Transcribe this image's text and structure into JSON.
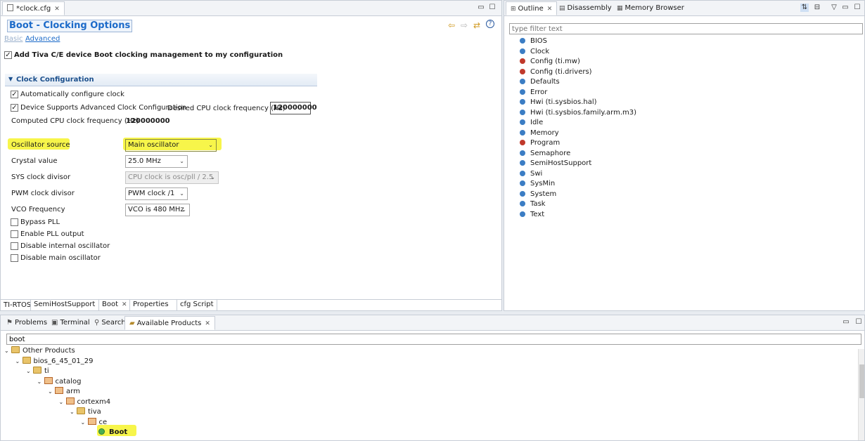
{
  "editor": {
    "tab_label": "*clock.cfg",
    "title": "Boot - Clocking Options",
    "mode_basic": "Basic",
    "mode_advanced": "Advanced",
    "add_config_label": "Add Tiva C/E device Boot clocking management to my configuration",
    "section_title": "Clock Configuration",
    "auto_config_label": "Automatically configure clock",
    "advanced_clock_label": "Device Supports Advanced Clock Configuration",
    "desired_freq_label": "Desired CPU clock frequency (Hz)",
    "desired_freq_value": "120000000",
    "computed_freq_label": "Computed CPU clock frequency (Hz)",
    "computed_freq_value": "120000000",
    "osc_source_label": "Oscillator source",
    "osc_source_value": "Main oscillator",
    "crystal_label": "Crystal value",
    "crystal_value": "25.0 MHz",
    "sys_div_label": "SYS clock divisor",
    "sys_div_value": "CPU clock is osc/pll / 2.5",
    "pwm_div_label": "PWM clock divisor",
    "pwm_div_value": "PWM clock /1",
    "vco_label": "VCO Frequency",
    "vco_value": "VCO is 480 MHz",
    "bypass_pll_label": "Bypass PLL",
    "enable_pll_label": "Enable PLL output",
    "disable_internal_label": "Disable internal oscillator",
    "disable_main_label": "Disable main oscillator",
    "bottom_tabs": [
      "TI-RTOS",
      "SemiHostSupport",
      "Boot",
      "Properties",
      "cfg Script"
    ]
  },
  "outline": {
    "tabs": [
      "Outline",
      "Disassembly",
      "Memory Browser"
    ],
    "filter_placeholder": "type filter text",
    "items": [
      {
        "label": "BIOS",
        "color": "#3b7dc4"
      },
      {
        "label": "Clock",
        "color": "#3b7dc4"
      },
      {
        "label": "Config (ti.mw)",
        "color": "#c0392b"
      },
      {
        "label": "Config (ti.drivers)",
        "color": "#c0392b"
      },
      {
        "label": "Defaults",
        "color": "#3b7dc4"
      },
      {
        "label": "Error",
        "color": "#3b7dc4"
      },
      {
        "label": "Hwi (ti.sysbios.hal)",
        "color": "#3b7dc4"
      },
      {
        "label": "Hwi (ti.sysbios.family.arm.m3)",
        "color": "#3b7dc4"
      },
      {
        "label": "Idle",
        "color": "#3b7dc4"
      },
      {
        "label": "Memory",
        "color": "#3b7dc4"
      },
      {
        "label": "Program",
        "color": "#c0392b"
      },
      {
        "label": "Semaphore",
        "color": "#3b7dc4"
      },
      {
        "label": "SemiHostSupport",
        "color": "#3b7dc4"
      },
      {
        "label": "Swi",
        "color": "#3b7dc4"
      },
      {
        "label": "SysMin",
        "color": "#3b7dc4"
      },
      {
        "label": "System",
        "color": "#3b7dc4"
      },
      {
        "label": "Task",
        "color": "#3b7dc4"
      },
      {
        "label": "Text",
        "color": "#3b7dc4"
      }
    ]
  },
  "bottom": {
    "tabs": [
      "Problems",
      "Terminal",
      "Search",
      "Available Products"
    ],
    "search_value": "boot",
    "tree": [
      {
        "label": "Other Products",
        "depth": 0,
        "icon": "folder"
      },
      {
        "label": "bios_6_45_01_29",
        "depth": 1,
        "icon": "folder"
      },
      {
        "label": "ti",
        "depth": 2,
        "icon": "folder"
      },
      {
        "label": "catalog",
        "depth": 3,
        "icon": "package"
      },
      {
        "label": "arm",
        "depth": 4,
        "icon": "package"
      },
      {
        "label": "cortexm4",
        "depth": 5,
        "icon": "package"
      },
      {
        "label": "tiva",
        "depth": 6,
        "icon": "folder"
      },
      {
        "label": "ce",
        "depth": 7,
        "icon": "package"
      },
      {
        "label": "Boot",
        "depth": 8,
        "icon": "module"
      }
    ]
  },
  "colors": {
    "accent": "#1b6ac9",
    "highlight": "#f7f54a"
  }
}
